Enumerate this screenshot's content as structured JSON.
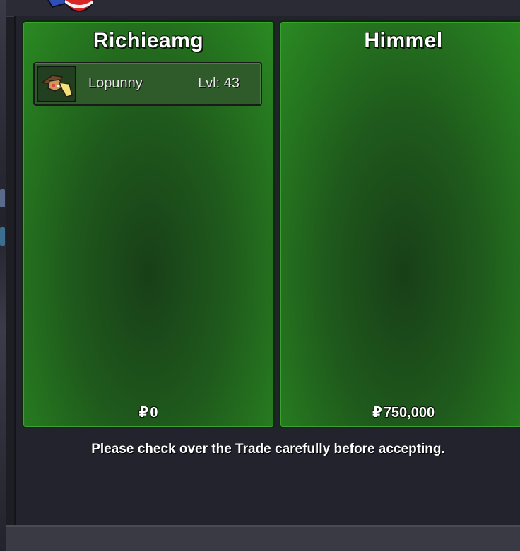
{
  "trade": {
    "left": {
      "trainer_name": "Richieamg",
      "pokemon": [
        {
          "name": "Lopunny",
          "level": "Lvl: 43",
          "icon": "lopunny-sprite-icon"
        }
      ],
      "money_symbol": "₽",
      "money": "0"
    },
    "right": {
      "trainer_name": "Himmel",
      "pokemon": [],
      "money_symbol": "₽",
      "money": "750,000"
    },
    "notice": "Please check over the Trade carefully before accepting."
  },
  "colors": {
    "panel_green": "#2a8a22",
    "panel_dark": "#183f18",
    "window_bg": "#23232e"
  },
  "icons": {
    "top_left": "pokeball-icon"
  }
}
